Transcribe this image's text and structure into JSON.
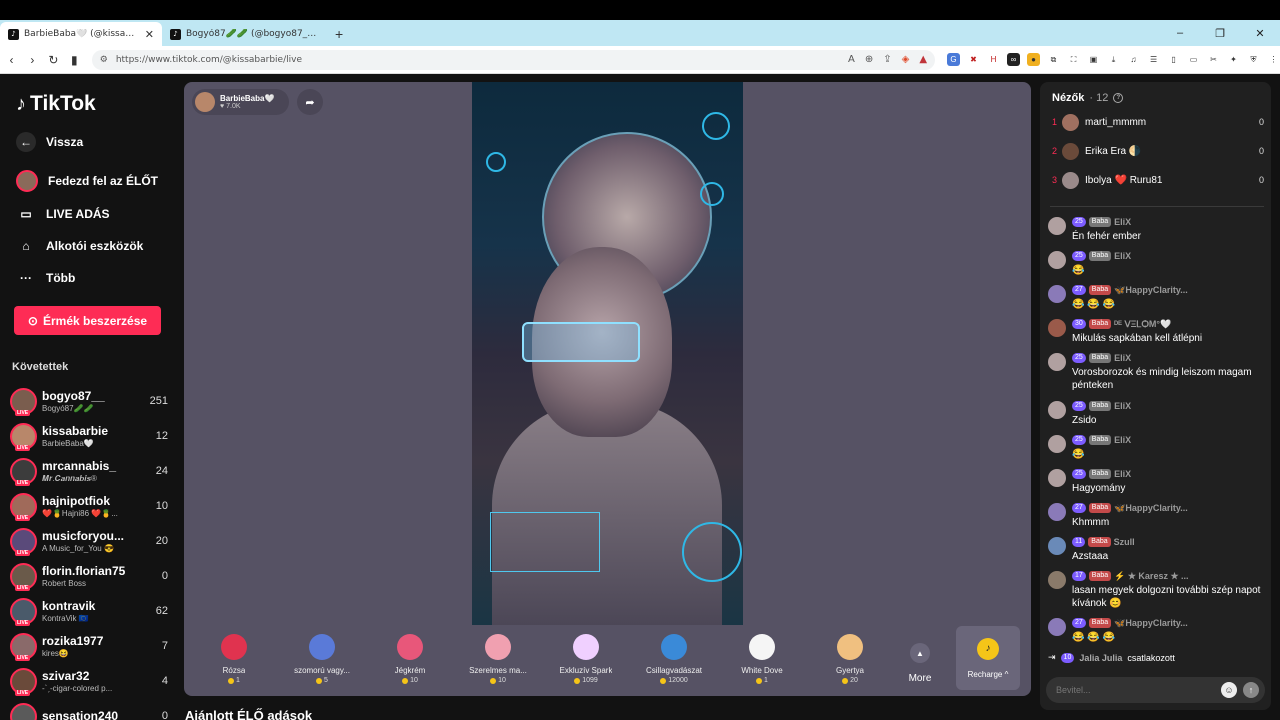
{
  "browser": {
    "tabs": [
      {
        "label": "BarbieBaba🤍 (@kissabarbie",
        "active": true
      },
      {
        "label": "Bogyó87🥒🥒 (@bogyo87__) Él",
        "active": false
      }
    ],
    "url": "https://www.tiktok.com/@kissabarbie/live",
    "window_controls": [
      "–",
      "❐",
      "✕"
    ]
  },
  "sidebar": {
    "logo": "TikTok",
    "back_label": "Vissza",
    "nav": [
      {
        "label": "Fedezd fel az ÉLŐT",
        "icon": "avatar-icon"
      },
      {
        "label": "LIVE ADÁS",
        "icon": "video-camera-icon"
      },
      {
        "label": "Alkotói eszközök",
        "icon": "lightbulb-icon"
      },
      {
        "label": "Több",
        "icon": "more-dots-icon"
      }
    ],
    "coin_button": "Érmék beszerzése",
    "following_header": "Követettek",
    "following": [
      {
        "name": "bogyo87__",
        "sub": "Bogyó87🥒🥒",
        "count": "251",
        "color": "#7a5d4e"
      },
      {
        "name": "kissabarbie",
        "sub": "BarbieBaba🤍",
        "count": "12",
        "color": "#b8876a"
      },
      {
        "name": "mrcannabis_",
        "sub": "𝑴𝒓.𝑪𝒂𝒏𝒏𝒂𝒃𝒊𝒔®",
        "count": "24",
        "color": "#3c3c3c"
      },
      {
        "name": "hajnipotfiok",
        "sub": "❤️🍍Hajni86 ❤️🍍...",
        "count": "10",
        "color": "#a06a5a"
      },
      {
        "name": "musicforyou...",
        "sub": "A Music_for_You 😎",
        "count": "20",
        "color": "#5a4a7a"
      },
      {
        "name": "florin.florian75",
        "sub": "Robert Boss",
        "count": "0",
        "color": "#6a5a4a"
      },
      {
        "name": "kontravik",
        "sub": "KontraVik 🇪🇺",
        "count": "62",
        "color": "#4a5a6a"
      },
      {
        "name": "rozika1977",
        "sub": "kires😆",
        "count": "7",
        "color": "#8a6a6a"
      },
      {
        "name": "szivar32",
        "sub": "-ˋˏ-cigar-colored p...",
        "count": "4",
        "color": "#6a4a3a"
      },
      {
        "name": "sensation240",
        "sub": "",
        "count": "0",
        "color": "#5a5a5a"
      }
    ]
  },
  "stream": {
    "host_name": "BarbieBaba🤍",
    "host_likes": "♥ 7.0K",
    "gifts": [
      {
        "name": "Rózsa",
        "price": "1",
        "color": "#e0334f"
      },
      {
        "name": "szomorú vagy...",
        "price": "5",
        "color": "#5a7ad8"
      },
      {
        "name": "Jégkrém",
        "price": "10",
        "color": "#e8577a"
      },
      {
        "name": "Szerelmes ma...",
        "price": "10",
        "color": "#f0a0b0"
      },
      {
        "name": "Exkluzív Spark",
        "price": "1099",
        "color": "#f0d0ff"
      },
      {
        "name": "Csillagvadászat",
        "price": "12000",
        "color": "#3a8ad8"
      },
      {
        "name": "White Dove",
        "price": "1",
        "color": "#f5f5f5"
      },
      {
        "name": "Gyertya",
        "price": "20",
        "color": "#f0c080"
      }
    ],
    "more_label": "More",
    "recharge_label": "Recharge ^"
  },
  "recommended_label": "Ajánlott ÉLŐ adások",
  "viewers": {
    "title": "Nézők",
    "count": "· 12",
    "list": [
      {
        "rank": "1",
        "name": "marti_mmmm",
        "score": "0",
        "color": "#a07060"
      },
      {
        "rank": "2",
        "name": "Erika Era 🌗",
        "score": "0",
        "color": "#6a4a3a"
      },
      {
        "rank": "3",
        "name": "Ibolya ❤️ Ruru81",
        "score": "0",
        "color": "#9a8a8a"
      }
    ]
  },
  "chat": [
    {
      "level": "25",
      "fan": "Baba",
      "user": "EliX",
      "text": "Én fehér ember",
      "color": "#b0a0a0",
      "fangray": true
    },
    {
      "level": "25",
      "fan": "Baba",
      "user": "EliX",
      "text": "😂",
      "color": "#b0a0a0",
      "fangray": true
    },
    {
      "level": "27",
      "fan": "Baba",
      "user": "🦋HappyClarity...",
      "text": "😂 😂 😂",
      "color": "#8a7ab8",
      "fangray": false
    },
    {
      "level": "30",
      "fan": "Baba",
      "user": "ᴰᴱ ᐯΞᏞѺM°🤍",
      "text": "Mikulás sapkában kell átlépni",
      "color": "#9a5a4a",
      "fangray": false
    },
    {
      "level": "25",
      "fan": "Baba",
      "user": "EliX",
      "text": "Vorosborozok és mindig leiszom magam pénteken",
      "color": "#b0a0a0",
      "fangray": true
    },
    {
      "level": "25",
      "fan": "Baba",
      "user": "EliX",
      "text": "Zsido",
      "color": "#b0a0a0",
      "fangray": true
    },
    {
      "level": "25",
      "fan": "Baba",
      "user": "EliX",
      "text": "😂",
      "color": "#b0a0a0",
      "fangray": true
    },
    {
      "level": "25",
      "fan": "Baba",
      "user": "EliX",
      "text": "Hagyomány",
      "color": "#b0a0a0",
      "fangray": true
    },
    {
      "level": "27",
      "fan": "Baba",
      "user": "🦋HappyClarity...",
      "text": "Khmmm",
      "color": "#8a7ab8",
      "fangray": false
    },
    {
      "level": "11",
      "fan": "Baba",
      "user": "Szull",
      "text": "Azstaaa",
      "color": "#6a8ab8",
      "fangray": false
    },
    {
      "level": "17",
      "fan": "Baba",
      "user": "⚡ ★ Karesz ★ ...",
      "text": "lasan megyek dolgozni további szép napot kívánok 😊",
      "color": "#8a7a6a",
      "fangray": false
    },
    {
      "level": "27",
      "fan": "Baba",
      "user": "🦋HappyClarity...",
      "text": "😂 😂 😂",
      "color": "#8a7ab8",
      "fangray": false
    }
  ],
  "join": {
    "level": "10",
    "user": "Jalia Julia",
    "text": "csatlakozott"
  },
  "chat_input": {
    "placeholder": "Bevitel..."
  }
}
